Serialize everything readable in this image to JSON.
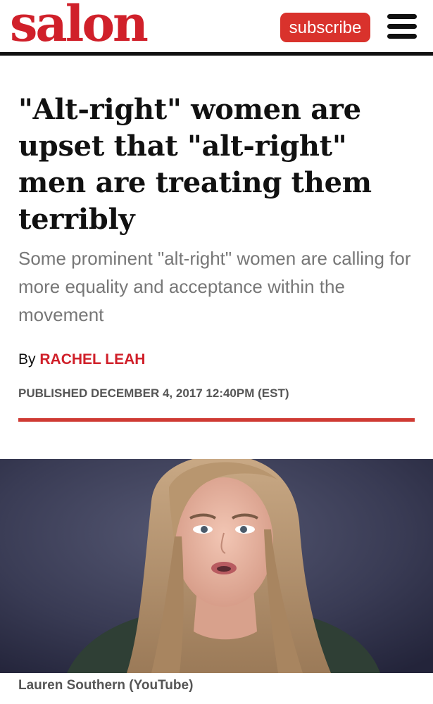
{
  "header": {
    "logo_text": "salon",
    "subscribe_label": "subscribe",
    "menu_icon": "hamburger-menu-icon",
    "brand_color": "#d0202a"
  },
  "article": {
    "headline": "\"Alt-right\" women are upset that \"alt-right\" men are treating them terribly",
    "dek": "Some prominent \"alt-right\" women are calling for more equality and acceptance within the movement",
    "byline_prefix": "By",
    "author": "RACHEL LEAH",
    "published": "PUBLISHED DECEMBER 4, 2017 12:40PM (EST)"
  },
  "hero_image": {
    "caption": "Lauren Southern (YouTube)"
  }
}
